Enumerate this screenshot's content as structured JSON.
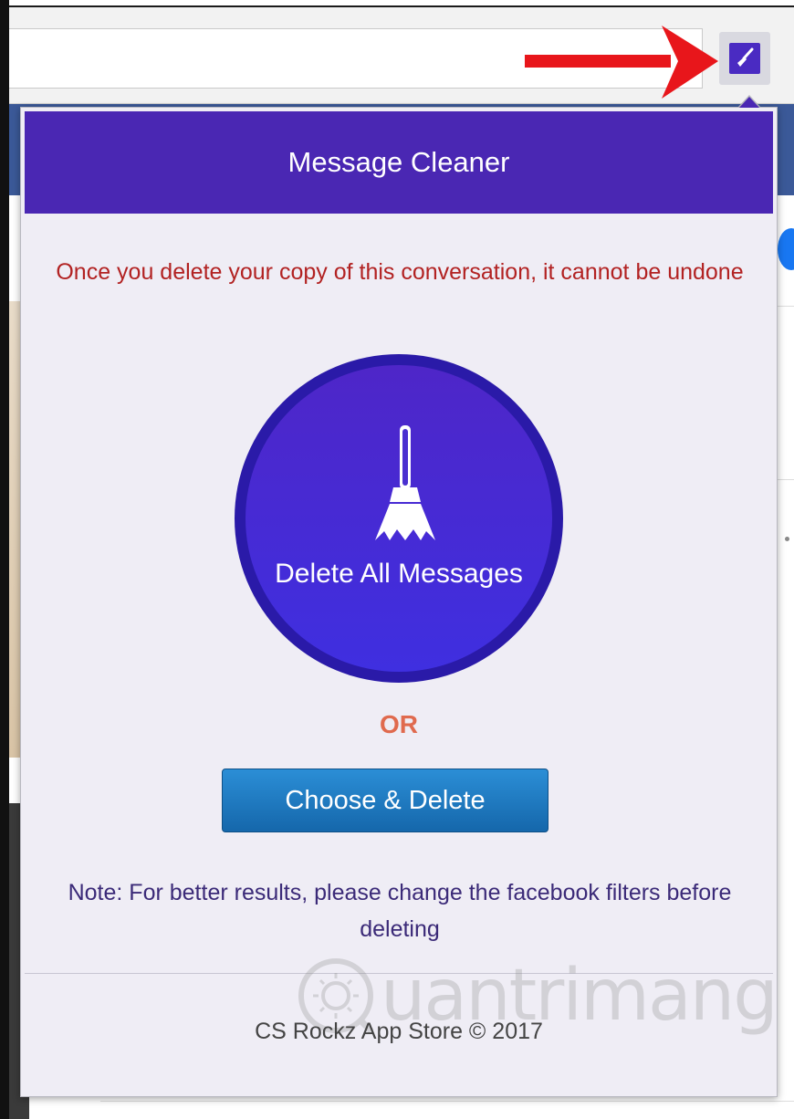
{
  "popup": {
    "title": "Message Cleaner",
    "warning": "Once you delete your copy of this conversation, it cannot be undone",
    "delete_all_label": "Delete All Messages",
    "or_label": "OR",
    "choose_delete_label": "Choose & Delete",
    "note": "Note: For better results, please change the facebook filters before deleting",
    "footer": "CS Rockz App Store © 2017"
  },
  "watermark": {
    "text": "uantrimang"
  },
  "icons": {
    "extension": "broom-icon",
    "annotation": "red-arrow-icon",
    "delete_all": "broom-icon"
  },
  "colors": {
    "brand_purple": "#4a27b3",
    "warning_red": "#b22222",
    "or_orange": "#e06a4e",
    "button_blue": "#1a78c2",
    "note_purple": "#3b2a78"
  }
}
